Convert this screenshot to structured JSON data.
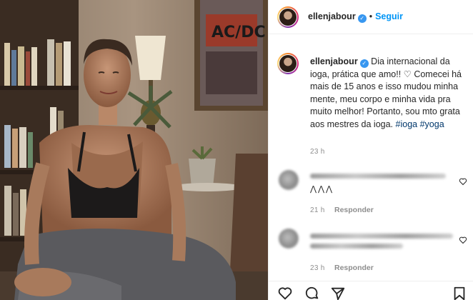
{
  "header": {
    "username": "ellenjabour",
    "separator": "•",
    "follow_label": "Seguir",
    "more_label": "..."
  },
  "caption": {
    "username": "ellenjabour",
    "text_before": "Dia internacional da ioga, prática que amo!! ♡ Comecei há mais de 15 anos e isso mudou minha mente, meu corpo e minha vida pra muito melhor! Portanto, sou mto grata aos mestres da ioga.",
    "hashtag_1": "#ioga",
    "hashtag_2": "#yoga",
    "time": "23 h"
  },
  "comments": [
    {
      "text_visible": "⋀⋀⋀",
      "time": "21 h",
      "reply_label": "Responder"
    },
    {
      "time": "23 h",
      "reply_label": "Responder"
    }
  ],
  "icons": {
    "like": "heart-icon",
    "comment": "comment-icon",
    "share": "share-icon",
    "save": "bookmark-icon",
    "verified": "verified-badge-icon"
  },
  "colors": {
    "follow": "#0095f6",
    "verified": "#3897f0",
    "hashtag": "#00376b",
    "muted": "#8e8e8e"
  }
}
